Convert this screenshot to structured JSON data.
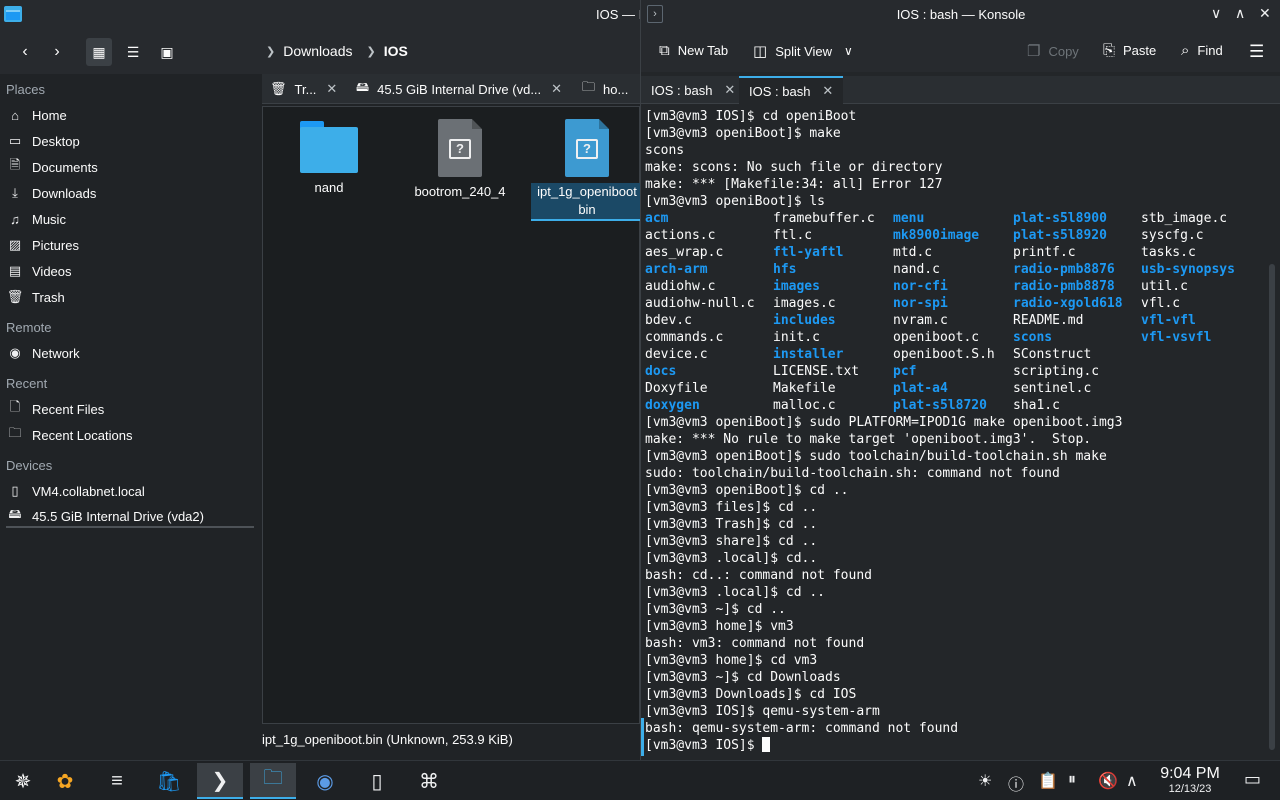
{
  "dolphin": {
    "window_title": "IOS — I",
    "breadcrumb": {
      "parent": "Downloads",
      "current": "IOS"
    },
    "places": {
      "places_header": "Places",
      "places_items": [
        {
          "label": "Home",
          "icon": "home-icon"
        },
        {
          "label": "Desktop",
          "icon": "desktop-icon"
        },
        {
          "label": "Documents",
          "icon": "documents-icon"
        },
        {
          "label": "Downloads",
          "icon": "downloads-icon"
        },
        {
          "label": "Music",
          "icon": "music-icon"
        },
        {
          "label": "Pictures",
          "icon": "pictures-icon"
        },
        {
          "label": "Videos",
          "icon": "videos-icon"
        },
        {
          "label": "Trash",
          "icon": "trash-icon"
        }
      ],
      "remote_header": "Remote",
      "remote_items": [
        {
          "label": "Network",
          "icon": "network-icon"
        }
      ],
      "recent_header": "Recent",
      "recent_items": [
        {
          "label": "Recent Files",
          "icon": "recent-files-icon"
        },
        {
          "label": "Recent Locations",
          "icon": "recent-locations-icon"
        }
      ],
      "devices_header": "Devices",
      "devices_items": [
        {
          "label": "VM4.collabnet.local",
          "icon": "device-icon"
        },
        {
          "label": "45.5 GiB Internal Drive (vda2)",
          "icon": "drive-icon"
        }
      ]
    },
    "tabs": [
      {
        "label": "Tr...",
        "icon": "trash-icon"
      },
      {
        "label": "45.5 GiB Internal Drive (vd...",
        "icon": "drive-icon"
      },
      {
        "label": "ho...",
        "icon": "folder-icon"
      }
    ],
    "files": [
      {
        "name": "nand",
        "type": "folder"
      },
      {
        "name": "bootrom_240_4",
        "type": "unknown"
      },
      {
        "name": "ipt_1g_openiboot.bin",
        "name_line1": "ipt_1g_openiboot",
        "name_line2": "bin",
        "type": "unknown-selected"
      }
    ],
    "status": "ipt_1g_openiboot.bin (Unknown, 253.9 KiB)"
  },
  "konsole": {
    "window_title": "IOS : bash — Konsole",
    "toolbar": {
      "new_tab": "New Tab",
      "split_view": "Split View",
      "copy": "Copy",
      "paste": "Paste",
      "find": "Find"
    },
    "tabs": [
      {
        "label": "IOS : bash"
      },
      {
        "label": "IOS : bash"
      }
    ],
    "lines_before_ls": [
      "[vm3@vm3 IOS]$ cd openiBoot",
      "[vm3@vm3 openiBoot]$ make",
      "scons",
      "make: scons: No such file or directory",
      "make: *** [Makefile:34: all] Error 127",
      "[vm3@vm3 openiBoot]$ ls"
    ],
    "ls_rows": [
      [
        {
          "t": "acm",
          "d": true
        },
        {
          "t": "framebuffer.c",
          "d": false
        },
        {
          "t": "menu",
          "d": true
        },
        {
          "t": "plat-s5l8900",
          "d": true
        },
        {
          "t": "stb_image.c",
          "d": false
        }
      ],
      [
        {
          "t": "actions.c",
          "d": false
        },
        {
          "t": "ftl.c",
          "d": false
        },
        {
          "t": "mk8900image",
          "d": true
        },
        {
          "t": "plat-s5l8920",
          "d": true
        },
        {
          "t": "syscfg.c",
          "d": false
        }
      ],
      [
        {
          "t": "aes_wrap.c",
          "d": false
        },
        {
          "t": "ftl-yaftl",
          "d": true
        },
        {
          "t": "mtd.c",
          "d": false
        },
        {
          "t": "printf.c",
          "d": false
        },
        {
          "t": "tasks.c",
          "d": false
        }
      ],
      [
        {
          "t": "arch-arm",
          "d": true
        },
        {
          "t": "hfs",
          "d": true
        },
        {
          "t": "nand.c",
          "d": false
        },
        {
          "t": "radio-pmb8876",
          "d": true
        },
        {
          "t": "usb-synopsys",
          "d": true
        }
      ],
      [
        {
          "t": "audiohw.c",
          "d": false
        },
        {
          "t": "images",
          "d": true
        },
        {
          "t": "nor-cfi",
          "d": true
        },
        {
          "t": "radio-pmb8878",
          "d": true
        },
        {
          "t": "util.c",
          "d": false
        }
      ],
      [
        {
          "t": "audiohw-null.c",
          "d": false
        },
        {
          "t": "images.c",
          "d": false
        },
        {
          "t": "nor-spi",
          "d": true
        },
        {
          "t": "radio-xgold618",
          "d": true
        },
        {
          "t": "vfl.c",
          "d": false
        }
      ],
      [
        {
          "t": "bdev.c",
          "d": false
        },
        {
          "t": "includes",
          "d": true
        },
        {
          "t": "nvram.c",
          "d": false
        },
        {
          "t": "README.md",
          "d": false
        },
        {
          "t": "vfl-vfl",
          "d": true
        }
      ],
      [
        {
          "t": "commands.c",
          "d": false
        },
        {
          "t": "init.c",
          "d": false
        },
        {
          "t": "openiboot.c",
          "d": false
        },
        {
          "t": "scons",
          "d": true
        },
        {
          "t": "vfl-vsvfl",
          "d": true
        }
      ],
      [
        {
          "t": "device.c",
          "d": false
        },
        {
          "t": "installer",
          "d": true
        },
        {
          "t": "openiboot.S.h",
          "d": false
        },
        {
          "t": "SConstruct",
          "d": false
        },
        {
          "t": "",
          "d": false
        }
      ],
      [
        {
          "t": "docs",
          "d": true
        },
        {
          "t": "LICENSE.txt",
          "d": false
        },
        {
          "t": "pcf",
          "d": true
        },
        {
          "t": "scripting.c",
          "d": false
        },
        {
          "t": "",
          "d": false
        }
      ],
      [
        {
          "t": "Doxyfile",
          "d": false
        },
        {
          "t": "Makefile",
          "d": false
        },
        {
          "t": "plat-a4",
          "d": true
        },
        {
          "t": "sentinel.c",
          "d": false
        },
        {
          "t": "",
          "d": false
        }
      ],
      [
        {
          "t": "doxygen",
          "d": true
        },
        {
          "t": "malloc.c",
          "d": false
        },
        {
          "t": "plat-s5l8720",
          "d": true
        },
        {
          "t": "sha1.c",
          "d": false
        },
        {
          "t": "",
          "d": false
        }
      ]
    ],
    "lines_after_ls": [
      "[vm3@vm3 openiBoot]$ sudo PLATFORM=IPOD1G make openiboot.img3",
      "make: *** No rule to make target 'openiboot.img3'.  Stop.",
      "[vm3@vm3 openiBoot]$ sudo toolchain/build-toolchain.sh make",
      "sudo: toolchain/build-toolchain.sh: command not found",
      "[vm3@vm3 openiBoot]$ cd ..",
      "[vm3@vm3 files]$ cd ..",
      "[vm3@vm3 Trash]$ cd ..",
      "[vm3@vm3 share]$ cd ..",
      "[vm3@vm3 .local]$ cd..",
      "bash: cd..: command not found",
      "[vm3@vm3 .local]$ cd ..",
      "[vm3@vm3 ~]$ cd ..",
      "[vm3@vm3 home]$ vm3",
      "bash: vm3: command not found",
      "[vm3@vm3 home]$ cd vm3",
      "[vm3@vm3 ~]$ cd Downloads",
      "[vm3@vm3 Downloads]$ cd IOS",
      "[vm3@vm3 IOS]$ qemu-system-arm",
      "bash: qemu-system-arm: command not found"
    ],
    "prompt": "[vm3@vm3 IOS]$ "
  },
  "taskbar": {
    "time": "9:04 PM",
    "date": "12/13/23"
  },
  "colors": {
    "accent": "#3daee9",
    "directory": "#1d99f3",
    "panel": "#202326",
    "terminal_bg": "#232629"
  }
}
